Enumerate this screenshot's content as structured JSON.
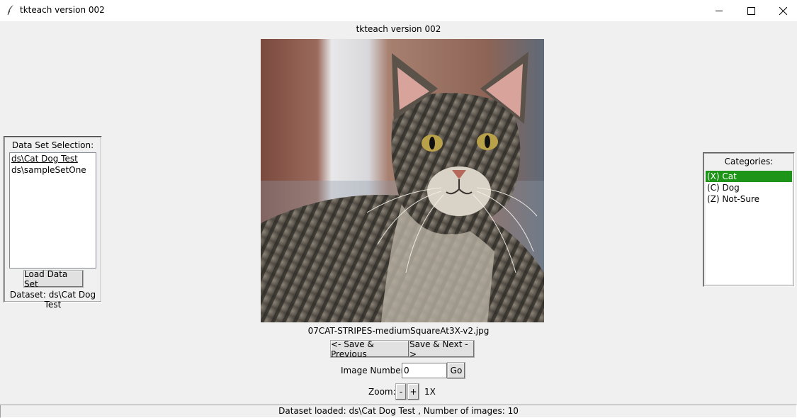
{
  "window": {
    "title": "tkteach version 002",
    "app_icon": "feather-icon",
    "controls": [
      "minimize-icon",
      "maximize-icon",
      "close-icon"
    ]
  },
  "app_heading": "tkteach version 002",
  "dataset_panel": {
    "label": "Data Set Selection:",
    "items": [
      "ds\\Cat Dog Test",
      "ds\\sampleSetOne"
    ],
    "active_index": 0,
    "load_button": "Load Data Set",
    "current_dataset": "Dataset: ds\\Cat Dog Test"
  },
  "categories_panel": {
    "label": "Categories:",
    "items": [
      "(X) Cat",
      "(C) Dog",
      "(Z) Not-Sure"
    ],
    "selected_index": 0,
    "selected_color": "#1e9418"
  },
  "image": {
    "filename": "07CAT-STRIPES-mediumSquareAt3X-v2.jpg",
    "description": "tabby cat photo"
  },
  "navigation": {
    "prev_button": "<- Save & Previous",
    "next_button": "Save & Next ->",
    "image_number_label": "Image Number:",
    "image_number_value": "0",
    "go_button": "Go",
    "zoom_label": "Zoom:",
    "zoom_minus": "-",
    "zoom_plus": "+",
    "zoom_value": "1X"
  },
  "status": "Dataset loaded: ds\\Cat Dog Test , Number of images: 10"
}
